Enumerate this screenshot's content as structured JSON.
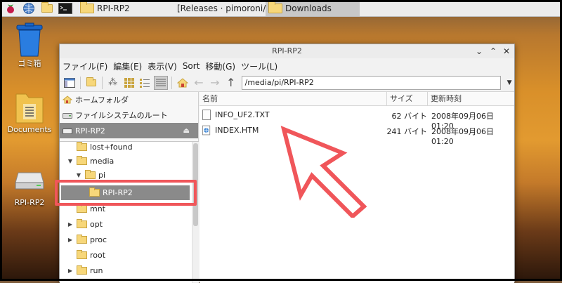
{
  "taskbar": {
    "tasks": [
      {
        "label": "RPI-RP2"
      },
      {
        "label": "[Releases · pimoroni/..."
      },
      {
        "label": "Downloads"
      }
    ]
  },
  "desktop": {
    "trash_label": "ゴミ箱",
    "documents_label": "Documents",
    "drive_label": "RPI-RP2"
  },
  "window": {
    "title": "RPI-RP2",
    "menu": [
      "ファイル(F)",
      "編集(E)",
      "表示(V)",
      "Sort",
      "移動(G)",
      "ツール(L)"
    ],
    "path": "/media/pi/RPI-RP2"
  },
  "sidebar": {
    "places": [
      {
        "label": "ホームフォルダ"
      },
      {
        "label": "ファイルシステムのルート"
      },
      {
        "label": "RPI-RP2"
      }
    ],
    "tree": [
      {
        "label": "lost+found"
      },
      {
        "label": "media"
      },
      {
        "label": "pi"
      },
      {
        "label": "RPI-RP2"
      },
      {
        "label": "mnt"
      },
      {
        "label": "opt"
      },
      {
        "label": "proc"
      },
      {
        "label": "root"
      },
      {
        "label": "run"
      }
    ]
  },
  "filelist": {
    "columns": [
      "名前",
      "サイズ",
      "更新時刻"
    ],
    "rows": [
      {
        "name": "INFO_UF2.TXT",
        "size": "62 バイト",
        "modified": "2008年09月06日 01:20"
      },
      {
        "name": "INDEX.HTM",
        "size": "241 バイト",
        "modified": "2008年09月06日 01:20"
      }
    ]
  },
  "colors": {
    "highlight": "#f0565a",
    "selection": "#8a8a8a"
  }
}
